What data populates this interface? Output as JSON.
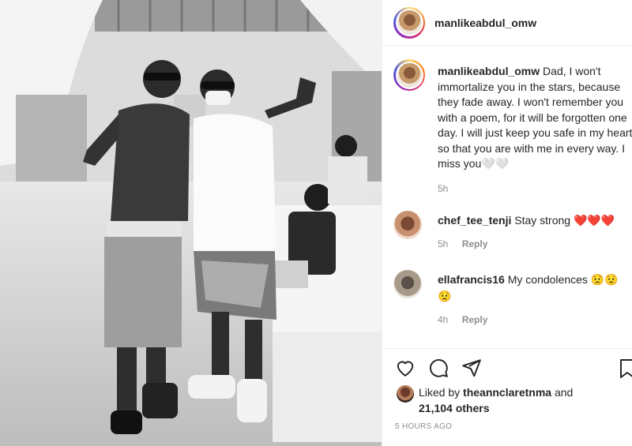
{
  "post": {
    "username": "manlikeabdul_omw",
    "caption": {
      "username": "manlikeabdul_omw",
      "text": "Dad, I won't immortalize you in the stars, because they fade away. I won't remember you with a poem, for it will be forgotten one day. I will just keep you safe in my heart, so that you are with me in every way. I miss you🤍🤍",
      "time": "5h"
    },
    "comments": [
      {
        "username": "chef_tee_tenji",
        "text": "Stay strong ❤️❤️❤️",
        "time": "5h",
        "reply": "Reply"
      },
      {
        "username": "ellafrancis16",
        "text": "My condolences 😟😟😟",
        "time": "4h",
        "reply": "Reply"
      }
    ],
    "likes": {
      "prefix": "Liked by",
      "user": "theannclaretnma",
      "connector": "and",
      "others": "21,104 others"
    },
    "time_ago": "5 HOURS AGO"
  },
  "icons": {
    "like": "heart-icon",
    "comment": "comment-icon",
    "share": "share-icon",
    "save": "bookmark-icon"
  },
  "colors": {
    "text": "#262626",
    "muted": "#8e8e8e",
    "border": "#efefef",
    "heart": "#c0392b"
  }
}
